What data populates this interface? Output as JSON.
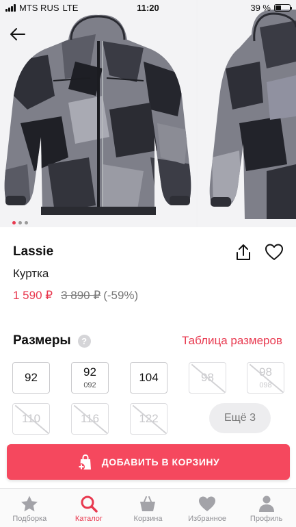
{
  "status_bar": {
    "carrier": "MTS RUS",
    "network": "LTE",
    "time": "11:20",
    "battery_percent_label": "39 %",
    "battery_level": 0.39
  },
  "gallery": {
    "photo_count": 3,
    "active_index": 0,
    "accent_color": "#e8394f"
  },
  "product": {
    "brand": "Lassie",
    "type": "Куртка",
    "price_current": "1 590 ₽",
    "price_old": "3 890 ₽",
    "discount": "(-59%)"
  },
  "sizes": {
    "title": "Размеры",
    "help_icon_label": "?",
    "chart_link": "Таблица размеров",
    "items": [
      {
        "main": "92",
        "sub": "",
        "available": true
      },
      {
        "main": "92",
        "sub": "092",
        "available": true
      },
      {
        "main": "104",
        "sub": "",
        "available": true
      },
      {
        "main": "98",
        "sub": "",
        "available": false
      },
      {
        "main": "98",
        "sub": "098",
        "available": false
      },
      {
        "main": "110",
        "sub": "",
        "available": false
      },
      {
        "main": "116",
        "sub": "",
        "available": false
      },
      {
        "main": "122",
        "sub": "",
        "available": false
      }
    ],
    "more_label": "Ещё 3"
  },
  "cart_button": {
    "label": "ДОБАВИТЬ В КОРЗИНУ",
    "icon": "bag-plus-icon",
    "color": "#f5485e"
  },
  "tab_bar": {
    "tabs": [
      {
        "label": "Подборка",
        "icon": "star-icon"
      },
      {
        "label": "Каталог",
        "icon": "search-icon"
      },
      {
        "label": "Корзина",
        "icon": "basket-icon"
      },
      {
        "label": "Избранное",
        "icon": "heart-icon"
      },
      {
        "label": "Профиль",
        "icon": "person-icon"
      }
    ],
    "active_index": 1
  }
}
